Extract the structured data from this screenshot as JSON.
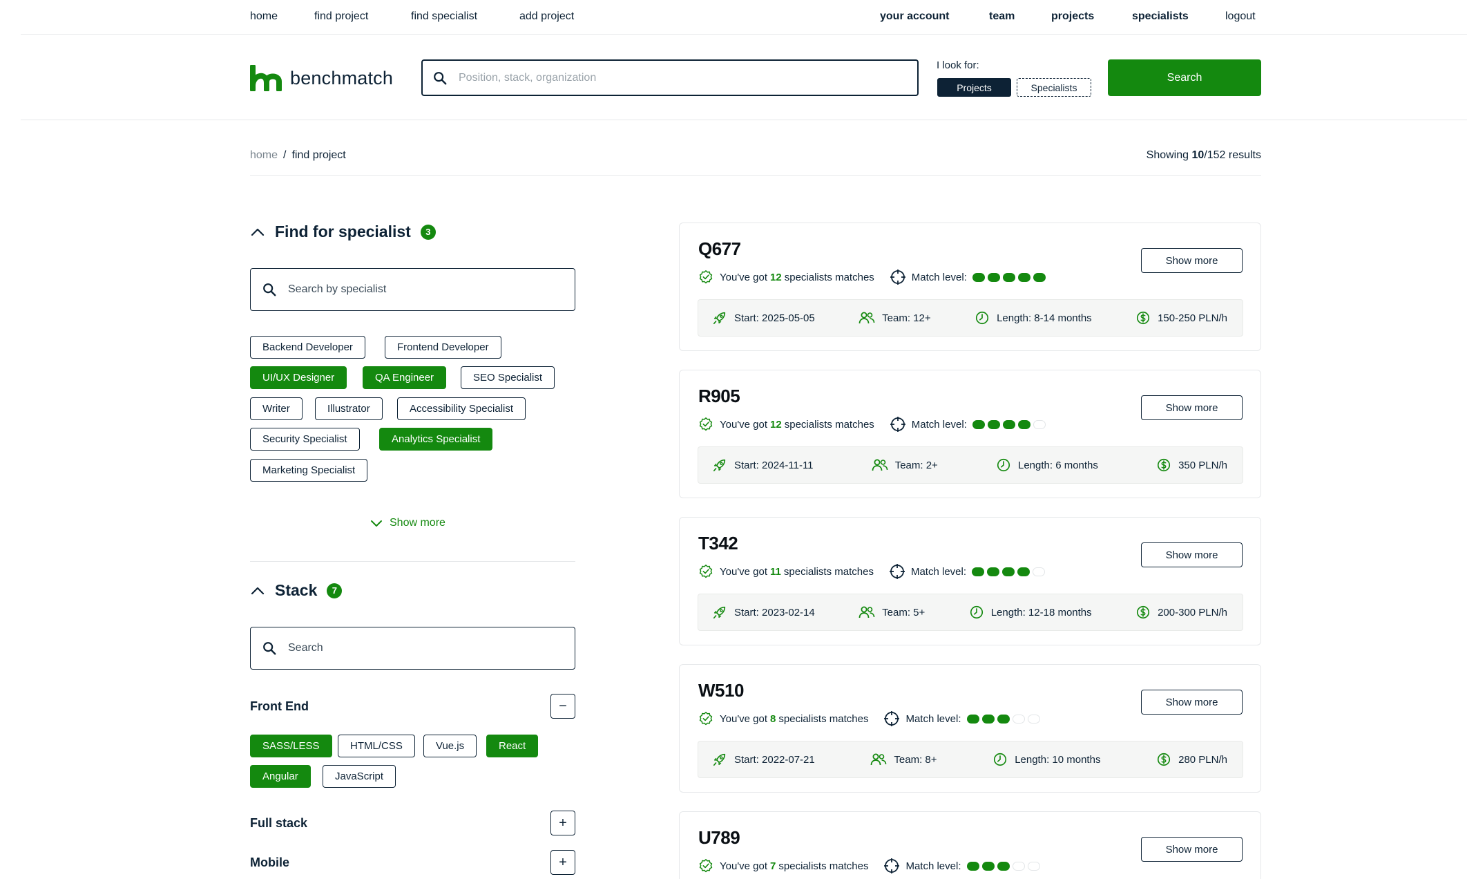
{
  "topnav": {
    "left": [
      "home",
      "find project",
      "find specialist",
      "add project"
    ],
    "right": [
      "your account",
      "team",
      "projects",
      "specialists",
      "logout"
    ]
  },
  "header": {
    "logo_text": "benchmatch",
    "search_placeholder": "Position, stack, organization",
    "look_for_label": "I look for:",
    "look_projects": "Projects",
    "look_specialists": "Specialists",
    "search_button": "Search"
  },
  "breadcrumb": {
    "home": "home",
    "sep": "/",
    "current": "find project"
  },
  "results": {
    "prefix": "Showing ",
    "shown": "10",
    "suffix": "/152 results"
  },
  "specialist_filter": {
    "title": "Find for specialist",
    "count": "3",
    "search_placeholder": "Search by specialist",
    "chips": [
      {
        "label": "Backend Developer",
        "selected": false
      },
      {
        "label": "Frontend Developer",
        "selected": false
      },
      {
        "label": "UI/UX Designer",
        "selected": true
      },
      {
        "label": "QA Engineer",
        "selected": true
      },
      {
        "label": "SEO Specialist",
        "selected": false
      },
      {
        "label": "Writer",
        "selected": false
      },
      {
        "label": "Illustrator",
        "selected": false
      },
      {
        "label": "Accessibility Specialist",
        "selected": false
      },
      {
        "label": "Security Specialist",
        "selected": false
      },
      {
        "label": "Analytics Specialist",
        "selected": true
      },
      {
        "label": "Marketing Specialist",
        "selected": false
      }
    ],
    "show_more": "Show more"
  },
  "stack_filter": {
    "title": "Stack",
    "count": "7",
    "search_placeholder": "Search",
    "groups": [
      {
        "title": "Front End",
        "toggle": "−"
      },
      {
        "title": "Full stack",
        "toggle": "+"
      },
      {
        "title": "Mobile",
        "toggle": "+"
      }
    ],
    "frontend_chips": [
      {
        "label": "SASS/LESS",
        "selected": true
      },
      {
        "label": "HTML/CSS",
        "selected": false
      },
      {
        "label": "Vue.js",
        "selected": false
      },
      {
        "label": "React",
        "selected": true
      },
      {
        "label": "Angular",
        "selected": true
      },
      {
        "label": "JavaScript",
        "selected": false
      }
    ]
  },
  "card_labels": {
    "matches_prefix": "You've got",
    "matches_suffix": "specialists matches",
    "match_level": "Match level:",
    "show_more": "Show more"
  },
  "projects": [
    {
      "code": "Q677",
      "matches": "12",
      "level": 5,
      "start": "Start: 2025-05-05",
      "team": "Team: 12+",
      "length": "Length: 8-14 months",
      "rate": "150-250 PLN/h"
    },
    {
      "code": "R905",
      "matches": "12",
      "level": 4,
      "start": "Start: 2024-11-11",
      "team": "Team: 2+",
      "length": "Length: 6 months",
      "rate": "350 PLN/h"
    },
    {
      "code": "T342",
      "matches": "11",
      "level": 4,
      "start": "Start: 2023-02-14",
      "team": "Team: 5+",
      "length": "Length: 12-18 months",
      "rate": "200-300 PLN/h"
    },
    {
      "code": "W510",
      "matches": "8",
      "level": 3,
      "start": "Start: 2022-07-21",
      "team": "Team: 8+",
      "length": "Length: 10 months",
      "rate": "280 PLN/h"
    },
    {
      "code": "U789",
      "matches": "7",
      "level": 3
    }
  ],
  "colors": {
    "accent": "#14890f",
    "navy": "#0d2235"
  }
}
